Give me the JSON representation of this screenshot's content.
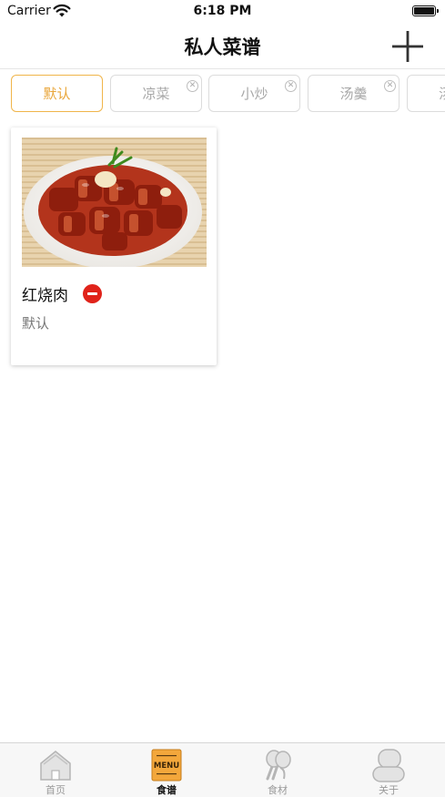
{
  "status_bar": {
    "carrier": "Carrier",
    "time": "6:18 PM"
  },
  "nav": {
    "title": "私人菜谱",
    "add_icon": "plus-icon"
  },
  "category_tabs": [
    {
      "label": "默认",
      "active": true,
      "removable": false
    },
    {
      "label": "凉菜",
      "active": false,
      "removable": true
    },
    {
      "label": "小炒",
      "active": false,
      "removable": true
    },
    {
      "label": "汤羹",
      "active": false,
      "removable": true
    },
    {
      "label": "汤",
      "active": false,
      "removable": false
    }
  ],
  "recipes": [
    {
      "name": "红烧肉",
      "category": "默认",
      "image": "braised-pork-photo"
    }
  ],
  "tab_bar": {
    "items": [
      {
        "label": "首页",
        "icon": "home-icon",
        "active": false
      },
      {
        "label": "食谱",
        "icon": "menu-book-icon",
        "active": true,
        "icon_text": "MENU"
      },
      {
        "label": "食材",
        "icon": "vegetable-icon",
        "active": false
      },
      {
        "label": "关于",
        "icon": "about-icon",
        "active": false
      }
    ]
  },
  "colors": {
    "accent": "#f0b54a",
    "delete": "#e0231a",
    "tab_inactive": "#999999"
  }
}
